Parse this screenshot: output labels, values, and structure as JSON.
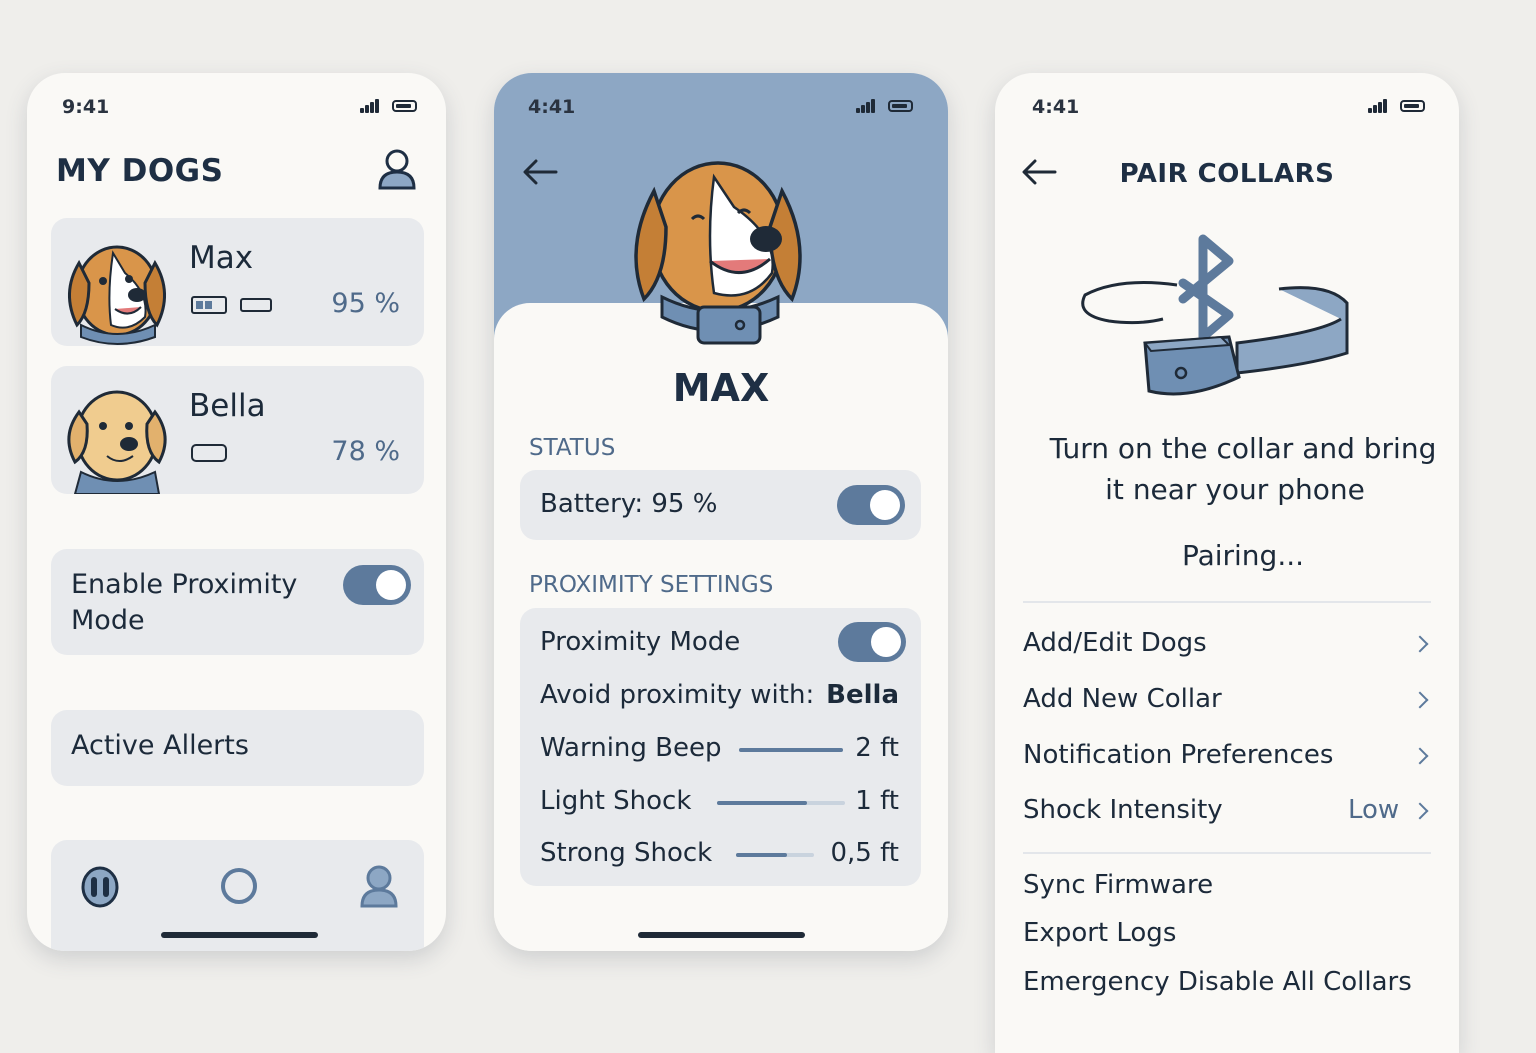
{
  "colors": {
    "accent": "#5d7a9c",
    "header_blue": "#8da7c4",
    "card": "#e8eaed",
    "text": "#1c2a3a"
  },
  "screen1": {
    "time": "9:41",
    "title": "MY DOGS",
    "dogs": [
      {
        "name": "Max",
        "percent": "95 %"
      },
      {
        "name": "Bella",
        "percent": "78 %"
      }
    ],
    "proximity_label": "Enable Proximity Mode",
    "proximity_on": true,
    "alerts_label": "Active Allerts",
    "nav_icons": [
      "dogs-icon",
      "home-icon",
      "profile-icon"
    ]
  },
  "screen2": {
    "time": "4:41",
    "dog_name": "MAX",
    "status_heading": "STATUS",
    "battery_label": "Battery: 95 %",
    "battery_toggle_on": true,
    "prox_heading": "PROXIMITY SETTINGS",
    "prox_mode_label": "Proximity Mode",
    "prox_mode_on": true,
    "avoid_label": "Avoid proximity with:",
    "avoid_value": "Bella",
    "levels": [
      {
        "label": "Warning Beep",
        "value": "2 ft",
        "level": 1.0
      },
      {
        "label": "Light Shock",
        "value": "1 ft",
        "level": 0.7
      },
      {
        "label": "Strong Shock",
        "value": "0,5 ft",
        "level": 0.65
      }
    ]
  },
  "screen3": {
    "time": "4:41",
    "title": "PAIR COLLARS",
    "instruction_line1": "Turn on the collar and bring",
    "instruction_line2": "it near your phone",
    "pairing_status": "Pairing...",
    "menu": [
      {
        "label": "Add/Edit Dogs",
        "value": ""
      },
      {
        "label": "Add New Collar",
        "value": ""
      },
      {
        "label": "Notification Preferences",
        "value": ""
      },
      {
        "label": "Shock Intensity",
        "value": "Low"
      }
    ],
    "actions": [
      "Sync Firmware",
      "Export Logs",
      "Emergency Disable All Collars"
    ]
  }
}
